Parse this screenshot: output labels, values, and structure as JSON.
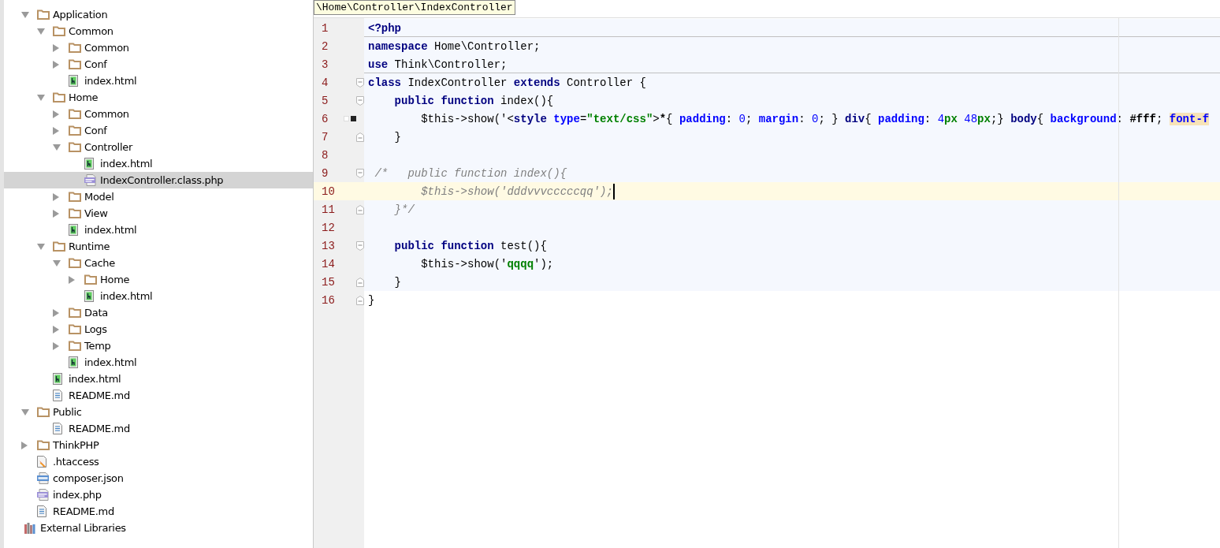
{
  "project_tree": [
    {
      "label": "Application",
      "kind": "folder",
      "expanded": true,
      "selected": false,
      "children": [
        {
          "label": "Common",
          "kind": "folder",
          "expanded": true,
          "selected": false,
          "children": [
            {
              "label": "Common",
              "kind": "folder",
              "expanded": false,
              "selected": false
            },
            {
              "label": "Conf",
              "kind": "folder",
              "expanded": false,
              "selected": false
            },
            {
              "label": "index.html",
              "kind": "html",
              "selected": false
            }
          ]
        },
        {
          "label": "Home",
          "kind": "folder",
          "expanded": true,
          "selected": false,
          "children": [
            {
              "label": "Common",
              "kind": "folder",
              "expanded": false,
              "selected": false
            },
            {
              "label": "Conf",
              "kind": "folder",
              "expanded": false,
              "selected": false
            },
            {
              "label": "Controller",
              "kind": "folder",
              "expanded": true,
              "selected": false,
              "children": [
                {
                  "label": "index.html",
                  "kind": "html",
                  "selected": false
                },
                {
                  "label": "IndexController.class.php",
                  "kind": "php",
                  "selected": true
                }
              ]
            },
            {
              "label": "Model",
              "kind": "folder",
              "expanded": false,
              "selected": false
            },
            {
              "label": "View",
              "kind": "folder",
              "expanded": false,
              "selected": false
            },
            {
              "label": "index.html",
              "kind": "html",
              "selected": false
            }
          ]
        },
        {
          "label": "Runtime",
          "kind": "folder",
          "expanded": true,
          "selected": false,
          "children": [
            {
              "label": "Cache",
              "kind": "folder",
              "expanded": true,
              "selected": false,
              "children": [
                {
                  "label": "Home",
                  "kind": "folder",
                  "expanded": false,
                  "selected": false
                },
                {
                  "label": "index.html",
                  "kind": "html",
                  "selected": false
                }
              ]
            },
            {
              "label": "Data",
              "kind": "folder",
              "expanded": false,
              "selected": false
            },
            {
              "label": "Logs",
              "kind": "folder",
              "expanded": false,
              "selected": false
            },
            {
              "label": "Temp",
              "kind": "folder",
              "expanded": false,
              "selected": false
            },
            {
              "label": "index.html",
              "kind": "html",
              "selected": false
            }
          ]
        },
        {
          "label": "index.html",
          "kind": "html",
          "selected": false
        },
        {
          "label": "README.md",
          "kind": "text",
          "selected": false
        }
      ]
    },
    {
      "label": "Public",
      "kind": "folder",
      "expanded": true,
      "selected": false,
      "children": [
        {
          "label": "README.md",
          "kind": "text",
          "selected": false
        }
      ]
    },
    {
      "label": "ThinkPHP",
      "kind": "folder",
      "expanded": false,
      "selected": false
    },
    {
      "label": ".htaccess",
      "kind": "htaccess",
      "selected": false
    },
    {
      "label": "composer.json",
      "kind": "json",
      "selected": false
    },
    {
      "label": "index.php",
      "kind": "php",
      "selected": false
    },
    {
      "label": "README.md",
      "kind": "text",
      "selected": false
    },
    {
      "label": "External Libraries",
      "kind": "libraries",
      "selected": false
    }
  ],
  "editor": {
    "breadcrumb": "\\Home\\Controller\\IndexController",
    "lines": [
      {
        "number": "1",
        "fold_start": false,
        "fold_end": false,
        "bookmark": false,
        "separator": true,
        "current": false,
        "tokens": [
          {
            "kind": "keyword",
            "text": "<?php"
          }
        ]
      },
      {
        "number": "2",
        "fold_start": false,
        "fold_end": false,
        "bookmark": false,
        "separator": false,
        "current": false,
        "tokens": [
          {
            "kind": "keyword",
            "text": "namespace"
          },
          {
            "kind": "plain",
            "text": " Home\\Controller;"
          }
        ]
      },
      {
        "number": "3",
        "fold_start": false,
        "fold_end": false,
        "bookmark": false,
        "separator": true,
        "current": false,
        "tokens": [
          {
            "kind": "keyword",
            "text": "use"
          },
          {
            "kind": "plain",
            "text": " Think\\Controller;"
          }
        ]
      },
      {
        "number": "4",
        "fold_start": true,
        "fold_end": false,
        "bookmark": false,
        "separator": false,
        "current": false,
        "tokens": [
          {
            "kind": "keyword",
            "text": "class"
          },
          {
            "kind": "plain",
            "text": " IndexController "
          },
          {
            "kind": "keyword",
            "text": "extends"
          },
          {
            "kind": "plain",
            "text": " Controller {"
          }
        ]
      },
      {
        "number": "5",
        "fold_start": true,
        "fold_end": false,
        "bookmark": false,
        "separator": false,
        "current": false,
        "tokens": [
          {
            "kind": "keyword",
            "text": "    public function"
          },
          {
            "kind": "plain",
            "text": " index(){"
          }
        ]
      },
      {
        "number": "6",
        "fold_start": false,
        "fold_end": false,
        "bookmark": true,
        "separator": false,
        "current": false,
        "tokens": [
          {
            "kind": "plain",
            "text": "        $this->show('<"
          },
          {
            "kind": "keyword",
            "text": "style"
          },
          {
            "kind": "attribute",
            "text": " type"
          },
          {
            "kind": "plain",
            "text": "="
          },
          {
            "kind": "string",
            "text": "\"text/css\""
          },
          {
            "kind": "plain",
            "text": ">"
          },
          {
            "kind": "bold",
            "text": "*"
          },
          {
            "kind": "plain",
            "text": "{ "
          },
          {
            "kind": "attribute",
            "text": "padding"
          },
          {
            "kind": "plain",
            "text": ": "
          },
          {
            "kind": "number",
            "text": "0"
          },
          {
            "kind": "plain",
            "text": "; "
          },
          {
            "kind": "attribute",
            "text": "margin"
          },
          {
            "kind": "plain",
            "text": ": "
          },
          {
            "kind": "number",
            "text": "0"
          },
          {
            "kind": "plain",
            "text": "; } "
          },
          {
            "kind": "keyword",
            "text": "div"
          },
          {
            "kind": "plain",
            "text": "{ "
          },
          {
            "kind": "attribute",
            "text": "padding"
          },
          {
            "kind": "plain",
            "text": ": "
          },
          {
            "kind": "number",
            "text": "4"
          },
          {
            "kind": "unit",
            "text": "px"
          },
          {
            "kind": "number",
            "text": " 48"
          },
          {
            "kind": "unit",
            "text": "px"
          },
          {
            "kind": "plain",
            "text": ";} "
          },
          {
            "kind": "keyword",
            "text": "body"
          },
          {
            "kind": "plain",
            "text": "{ "
          },
          {
            "kind": "attribute",
            "text": "background"
          },
          {
            "kind": "plain",
            "text": ": "
          },
          {
            "kind": "bold",
            "text": "#fff"
          },
          {
            "kind": "plain",
            "text": "; "
          },
          {
            "kind": "highlight",
            "text": "font-f"
          }
        ]
      },
      {
        "number": "7",
        "fold_start": false,
        "fold_end": true,
        "bookmark": false,
        "separator": false,
        "current": false,
        "tokens": [
          {
            "kind": "plain",
            "text": "    }"
          }
        ]
      },
      {
        "number": "8",
        "fold_start": false,
        "fold_end": false,
        "bookmark": false,
        "separator": false,
        "current": false
      },
      {
        "number": "9",
        "fold_start": true,
        "fold_end": false,
        "bookmark": false,
        "separator": false,
        "current": false,
        "tokens": [
          {
            "kind": "comment",
            "text": " /*   public function index(){"
          }
        ]
      },
      {
        "number": "10",
        "fold_start": false,
        "fold_end": false,
        "bookmark": false,
        "separator": false,
        "current": true,
        "tokens": [
          {
            "kind": "comment",
            "text": "        $this->show('dddvvvcccccqq');"
          }
        ]
      },
      {
        "number": "11",
        "fold_start": false,
        "fold_end": true,
        "bookmark": false,
        "separator": false,
        "current": false,
        "tokens": [
          {
            "kind": "comment",
            "text": "    }*/"
          }
        ]
      },
      {
        "number": "12",
        "fold_start": false,
        "fold_end": false,
        "bookmark": false,
        "separator": false,
        "current": false
      },
      {
        "number": "13",
        "fold_start": true,
        "fold_end": false,
        "bookmark": false,
        "separator": false,
        "current": false,
        "tokens": [
          {
            "kind": "keyword",
            "text": "    public function"
          },
          {
            "kind": "plain",
            "text": " test(){"
          }
        ]
      },
      {
        "number": "14",
        "fold_start": false,
        "fold_end": false,
        "bookmark": false,
        "separator": false,
        "current": false,
        "tokens": [
          {
            "kind": "plain",
            "text": "        $this->show('"
          },
          {
            "kind": "string",
            "text": "qqqq"
          },
          {
            "kind": "plain",
            "text": "');"
          }
        ]
      },
      {
        "number": "15",
        "fold_start": false,
        "fold_end": true,
        "bookmark": false,
        "separator": false,
        "current": false,
        "tokens": [
          {
            "kind": "plain",
            "text": "    }"
          }
        ]
      },
      {
        "number": "16",
        "fold_start": false,
        "fold_end": true,
        "bookmark": false,
        "separator": false,
        "current": false,
        "tokens": [
          {
            "kind": "plain",
            "text": "}"
          }
        ]
      }
    ]
  }
}
